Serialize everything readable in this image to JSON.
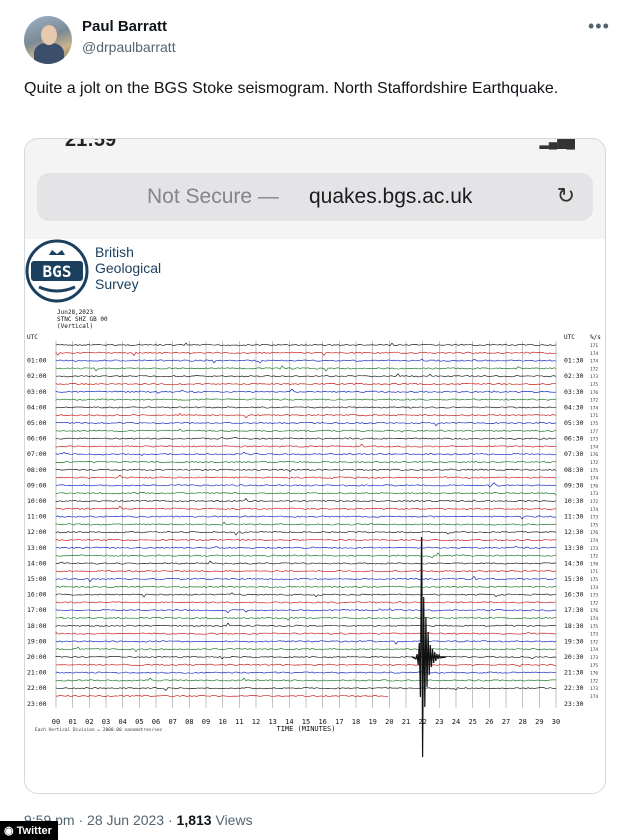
{
  "author": {
    "name": "Paul Barratt",
    "handle": "@drpaulbarratt"
  },
  "more_icon": "more-dots-icon",
  "tweet": {
    "text": "Quite a jolt on the BGS Stoke seismogram. North Staffordshire Earthquake."
  },
  "browser": {
    "status_time": "21:59",
    "url_prefix": "Not Secure —",
    "url_domain": "quakes.bgs.ac.uk",
    "reload_icon": "reload-icon"
  },
  "bgs": {
    "logo_text": "BGS",
    "name_lines": [
      "British",
      "Geological",
      "Survey"
    ]
  },
  "seismogram": {
    "header_lines": [
      "Jun28,2023",
      "STNC SHZ GB 00",
      "(Vertical)"
    ],
    "left_utc_label": "UTC",
    "right_utc_label": "UTC",
    "right_col_label": "%/s",
    "left_hours": [
      "01:00",
      "02:00",
      "03:00",
      "04:00",
      "05:00",
      "06:00",
      "07:00",
      "08:00",
      "09:00",
      "10:00",
      "11:00",
      "12:00",
      "13:00",
      "14:00",
      "15:00",
      "16:00",
      "17:00",
      "18:00",
      "19:00",
      "20:00",
      "21:00",
      "22:00",
      "23:00"
    ],
    "right_hours": [
      "01:30",
      "02:30",
      "03:30",
      "04:30",
      "05:30",
      "06:30",
      "07:30",
      "08:30",
      "09:30",
      "10:30",
      "11:30",
      "12:30",
      "13:30",
      "14:30",
      "15:30",
      "16:30",
      "17:30",
      "18:30",
      "19:30",
      "20:30",
      "21:30",
      "22:30",
      "23:30"
    ],
    "right_values": [
      "171",
      "174",
      "174",
      "172",
      "173",
      "175",
      "176",
      "172",
      "174",
      "171",
      "175",
      "177",
      "173",
      "174",
      "176",
      "172",
      "175",
      "174",
      "176",
      "173",
      "172",
      "174",
      "173",
      "175",
      "176",
      "174",
      "173",
      "172",
      "170",
      "171",
      "175",
      "174",
      "173",
      "172",
      "176",
      "174",
      "175",
      "173",
      "172",
      "174",
      "173",
      "175",
      "176",
      "172",
      "173",
      "174"
    ],
    "minute_ticks": [
      "00",
      "01",
      "02",
      "03",
      "04",
      "05",
      "06",
      "07",
      "08",
      "09",
      "10",
      "11",
      "12",
      "13",
      "14",
      "15",
      "16",
      "17",
      "18",
      "19",
      "20",
      "21",
      "22",
      "23",
      "24",
      "25",
      "26",
      "27",
      "28",
      "29",
      "30"
    ],
    "x_axis_label": "TIME (MINUTES)",
    "division_note": "Each Vertical Division = 2000.00 nanometres/sec",
    "trace_colors": [
      "#222222",
      "#cc2222",
      "#1a2fbf",
      "#1f7a2a"
    ],
    "event_minute": 21.6
  },
  "meta": {
    "time": "9:59 pm · 28 Jun 2023 · ",
    "views_count": "1,813",
    "views_label": " Views"
  },
  "watermark": "Twitter"
}
